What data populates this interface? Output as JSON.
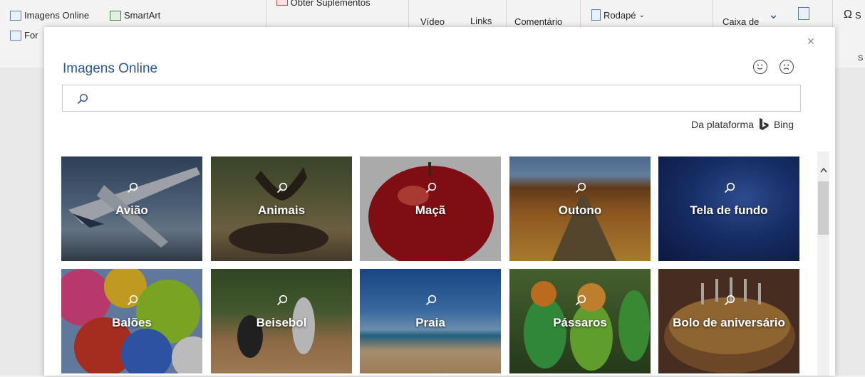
{
  "ribbon": {
    "online_images": "Imagens Online",
    "smartart": "SmartArt",
    "forms_clip": "For",
    "get_addins_clip": "Obter Suplementos",
    "video_clip": "Vídeo",
    "links_clip": "Links",
    "comment_clip": "Comentário",
    "footer": "Rodapé",
    "textbox_clip": "Caixa de",
    "symbol_clip": "S",
    "group_clip": "S"
  },
  "dialog": {
    "title": "Imagens Online",
    "close_glyph": "×",
    "search_placeholder": "",
    "platform_label": "Da plataforma",
    "bing_label": "Bing"
  },
  "tiles": [
    {
      "label": "Avião"
    },
    {
      "label": "Animais"
    },
    {
      "label": "Maçã"
    },
    {
      "label": "Outono"
    },
    {
      "label": "Tela de fundo"
    },
    {
      "label": "Balões"
    },
    {
      "label": "Beisebol"
    },
    {
      "label": "Praia"
    },
    {
      "label": "Pássaros"
    },
    {
      "label": "Bolo de aniversário"
    }
  ],
  "colors": {
    "title_blue": "#2b579a",
    "bing_dark": "#333333"
  },
  "icons": [
    "search-icon",
    "smile-icon",
    "frown-icon",
    "close-icon",
    "bing-logo-icon",
    "magnifier-icon",
    "chevron-up-icon"
  ]
}
